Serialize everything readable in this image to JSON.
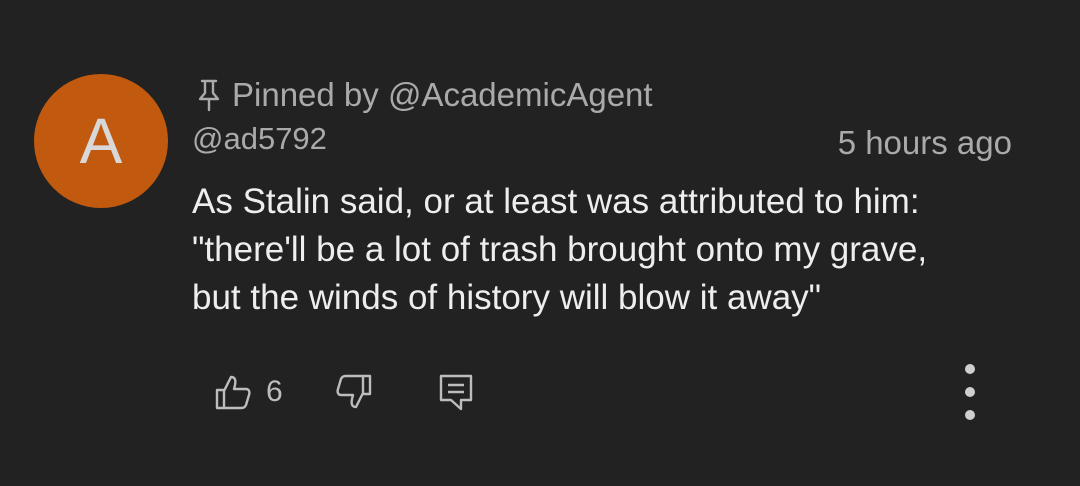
{
  "comment": {
    "avatar": {
      "letter": "A",
      "color": "#c15a0e"
    },
    "pinned": {
      "icon": "pin-icon",
      "text": "Pinned by @AcademicAgent"
    },
    "author_handle": "@ad5792",
    "timestamp": "5 hours ago",
    "body_lines": [
      "As Stalin said, or at least was attributed to him:",
      "\"there'll be a lot of trash brought onto my grave,",
      "but the winds of history will blow it away\""
    ],
    "actions": {
      "like_icon": "thumbs-up-icon",
      "like_count": "6",
      "dislike_icon": "thumbs-down-icon",
      "reply_icon": "reply-comment-icon",
      "more_icon": "more-vertical-icon"
    }
  }
}
